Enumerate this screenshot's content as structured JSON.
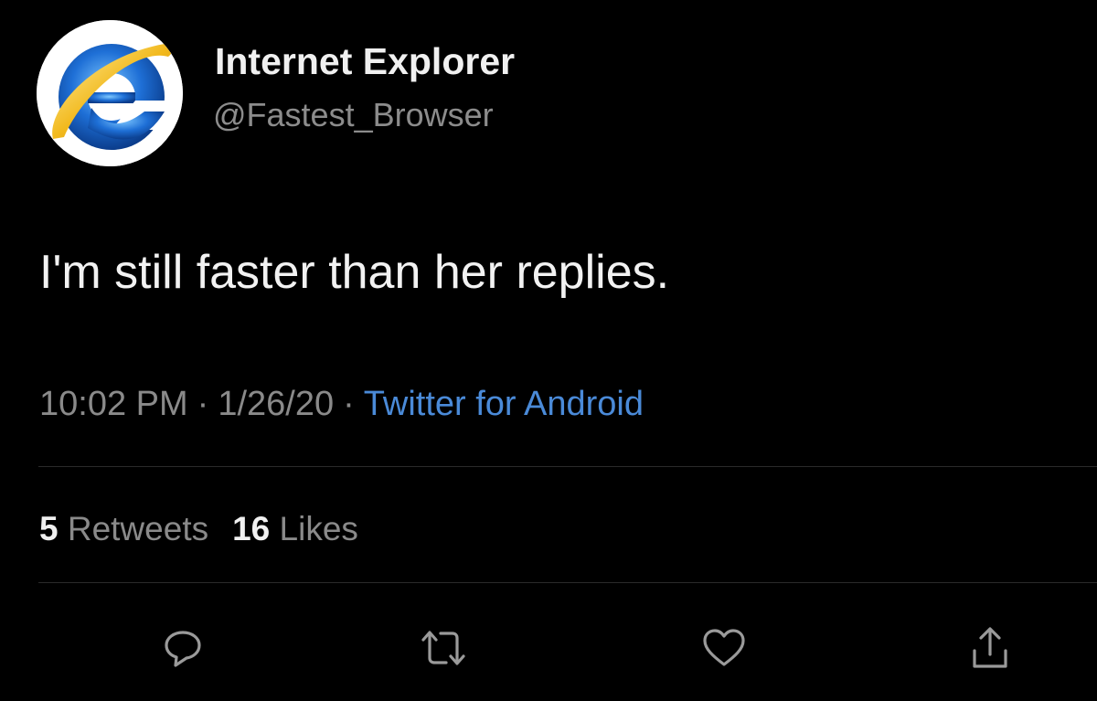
{
  "user": {
    "display_name": "Internet Explorer",
    "handle": "@Fastest_Browser",
    "avatar_icon": "internet-explorer-logo"
  },
  "tweet": {
    "text": "I'm still faster than her replies.",
    "time": "10:02 PM",
    "date": "1/26/20",
    "separator": "·",
    "source": "Twitter for Android"
  },
  "stats": {
    "retweets_count": "5",
    "retweets_label": "Retweets",
    "likes_count": "16",
    "likes_label": "Likes"
  },
  "actions": {
    "reply_icon": "reply-icon",
    "retweet_icon": "retweet-icon",
    "like_icon": "heart-icon",
    "share_icon": "share-icon"
  },
  "colors": {
    "background": "#000000",
    "source_link": "#4a8ad8",
    "muted_text": "#8a8a8a",
    "icon": "#9a9a9a"
  }
}
